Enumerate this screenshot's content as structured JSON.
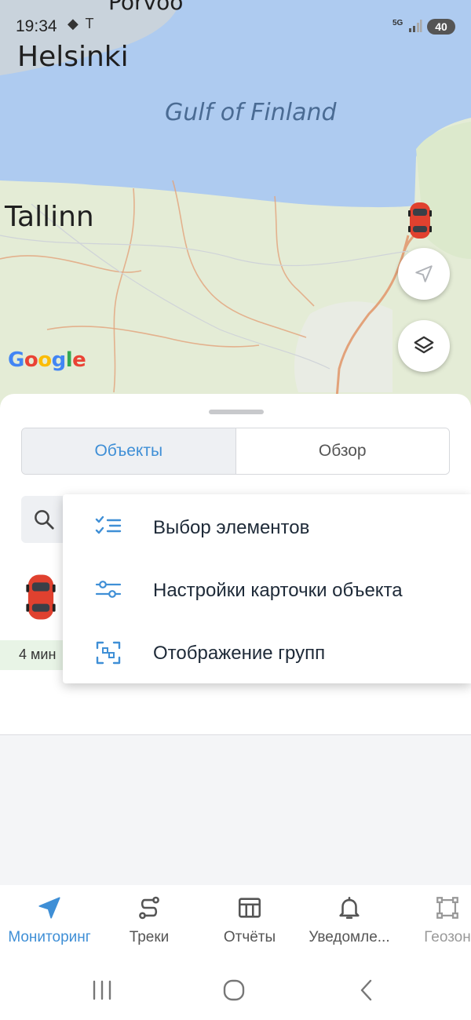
{
  "status_bar": {
    "time": "19:34",
    "network": "5G",
    "battery": "40"
  },
  "map": {
    "labels": {
      "porvoo": "Porvoo",
      "helsinki": "Helsinki",
      "gulf": "Gulf of Finland",
      "tallinn": "Tallinn"
    },
    "attribution": "Google",
    "buttons": {
      "locate_icon": "navigation-arrow-icon",
      "layers_icon": "layers-icon"
    }
  },
  "sheet": {
    "tabs": [
      {
        "label": "Объекты",
        "active": true
      },
      {
        "label": "Обзор",
        "active": false
      }
    ],
    "object_time": "4 мин"
  },
  "context_menu": {
    "items": [
      {
        "label": "Выбор элементов",
        "icon": "checklist-icon"
      },
      {
        "label": "Настройки карточки объекта",
        "icon": "sliders-icon"
      },
      {
        "label": "Отображение групп",
        "icon": "group-frame-icon"
      }
    ]
  },
  "bottom_nav": {
    "items": [
      {
        "label": "Мониторинг",
        "icon": "navigation-icon",
        "active": true
      },
      {
        "label": "Треки",
        "icon": "route-icon",
        "active": false
      },
      {
        "label": "Отчёты",
        "icon": "table-icon",
        "active": false
      },
      {
        "label": "Уведомле...",
        "icon": "bell-icon",
        "active": false
      },
      {
        "label": "Геозон",
        "icon": "geofence-icon",
        "active": false
      }
    ]
  },
  "colors": {
    "accent": "#3f8fd6",
    "sea": "#aecbf0",
    "land": "#e4ecd6",
    "border": "#e2a27a",
    "car": "#e0412f"
  }
}
